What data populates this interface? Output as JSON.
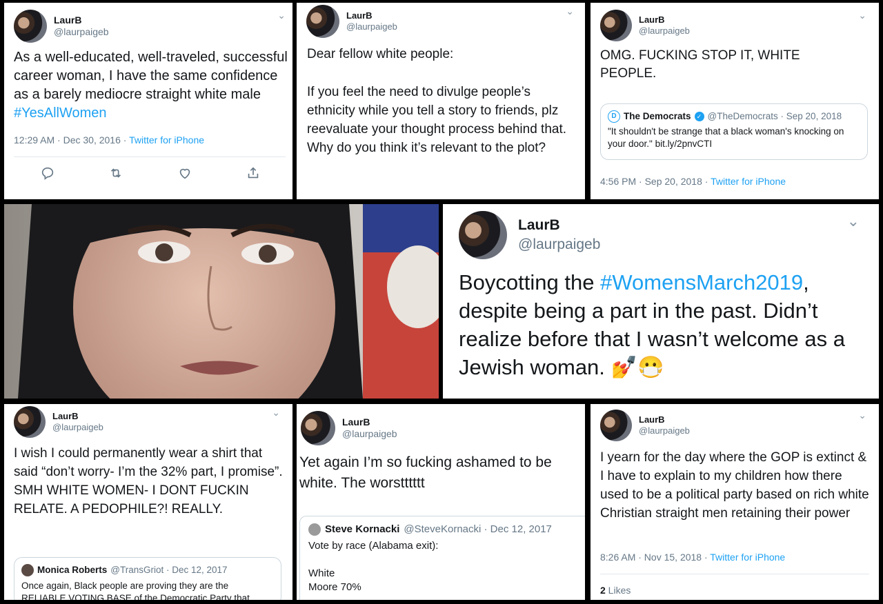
{
  "user": {
    "display_name": "LaurB",
    "handle": "@laurpaigeb"
  },
  "colors": {
    "link": "#1da1f2",
    "verified": "#1da1f2",
    "meta": "#657786"
  },
  "tweets": [
    {
      "text_before": "As a well-educated, well-traveled, successful career woman, I have the same confidence as a barely mediocre straight white male ",
      "hashtag": "#YesAllWomen",
      "time": "12:29 AM · Dec 30, 2016 · ",
      "app": "Twitter for iPhone",
      "action_icons": [
        "reply-icon",
        "retweet-icon",
        "like-icon",
        "share-icon"
      ]
    },
    {
      "line1": "Dear fellow white people:",
      "line2": "If you feel the need to divulge people’s ethnicity while you tell a story to friends, plz reevaluate your thought process behind that. Why do you think it’s relevant to the plot?"
    },
    {
      "text": "OMG. FUCKING STOP IT, WHITE PEOPLE.",
      "quote": {
        "name": "The Democrats",
        "meta": "@TheDemocrats · Sep 20, 2018",
        "text": "\"It shouldn't be strange that a black woman's knocking on your door.\" bit.ly/2pnvCTI"
      },
      "time": "4:56 PM · Sep 20, 2018 · ",
      "app": "Twitter for iPhone"
    },
    {
      "text_before": "Boycotting the ",
      "hashtag": "#WomensMarch2019",
      "text_after": ", despite being a part in the past. Didn’t realize before that I wasn’t welcome as a Jewish woman. 💅😷"
    },
    {
      "text": "I wish I could permanently wear a shirt that said “don’t worry- I’m the 32% part, I promise”. SMH WHITE WOMEN- I DONT FUCKIN RELATE. A PEDOPHILE?! REALLY.",
      "quote": {
        "name": "Monica Roberts",
        "meta": "@TransGriot · Dec 12, 2017",
        "text": "Once again, Black people are proving they are the RELIABLE VOTING BASE of the Democratic Party that"
      }
    },
    {
      "text": "Yet again I’m so fucking ashamed to be white. The worstttttt",
      "quote": {
        "name": "Steve Kornacki",
        "meta": "@SteveKornacki · Dec 12, 2017",
        "line1": "Vote by race (Alabama exit):",
        "line2": "White",
        "line3": "Moore 70%"
      }
    },
    {
      "text": "I yearn for the day where the GOP is extinct & I have to explain to my children how there used to be a political party based on rich white Christian straight men retaining their power",
      "time": "8:26 AM · Nov 15, 2018 · ",
      "app": "Twitter for iPhone",
      "likes_count": "2",
      "likes_label": " Likes"
    }
  ]
}
